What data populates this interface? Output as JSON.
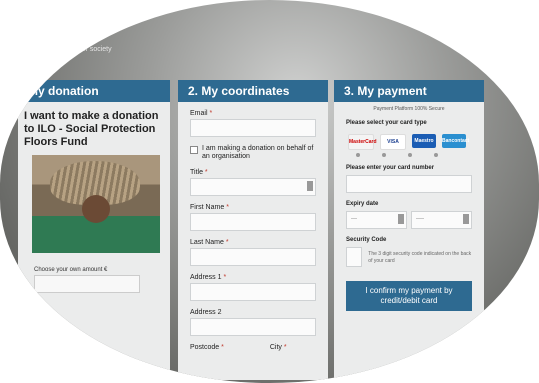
{
  "background_text": "better society",
  "donation_panel": {
    "header": "My donation",
    "title": "I want to make a donation to ILO - Social Protection Floors Fund",
    "amount_label": "Choose your own amount €",
    "amount_value": ""
  },
  "coordinates_panel": {
    "header": "2. My coordinates",
    "email_label": "Email",
    "org_checkbox_label": "I am making a donation on behalf of an organisation",
    "title_label": "Title",
    "first_name_label": "First Name",
    "last_name_label": "Last Name",
    "address1_label": "Address 1",
    "address2_label": "Address 2",
    "postcode_label": "Postcode",
    "city_label": "City",
    "required_marker": "*"
  },
  "payment_panel": {
    "header": "3. My payment",
    "platform_text": "Payment Platform 100% Secure",
    "card_type_label": "Please select your card type",
    "cards": [
      "MasterCard",
      "VISA",
      "Maestro",
      "Bancontact"
    ],
    "card_number_label": "Please enter your card number",
    "expiry_label": "Expiry date",
    "expiry_month_placeholder": "---",
    "expiry_year_placeholder": "----",
    "security_label": "Security Code",
    "security_hint": "The 3 digit security code indicated on the back of your card",
    "confirm_button": "I confirm my payment by credit/debit card"
  }
}
